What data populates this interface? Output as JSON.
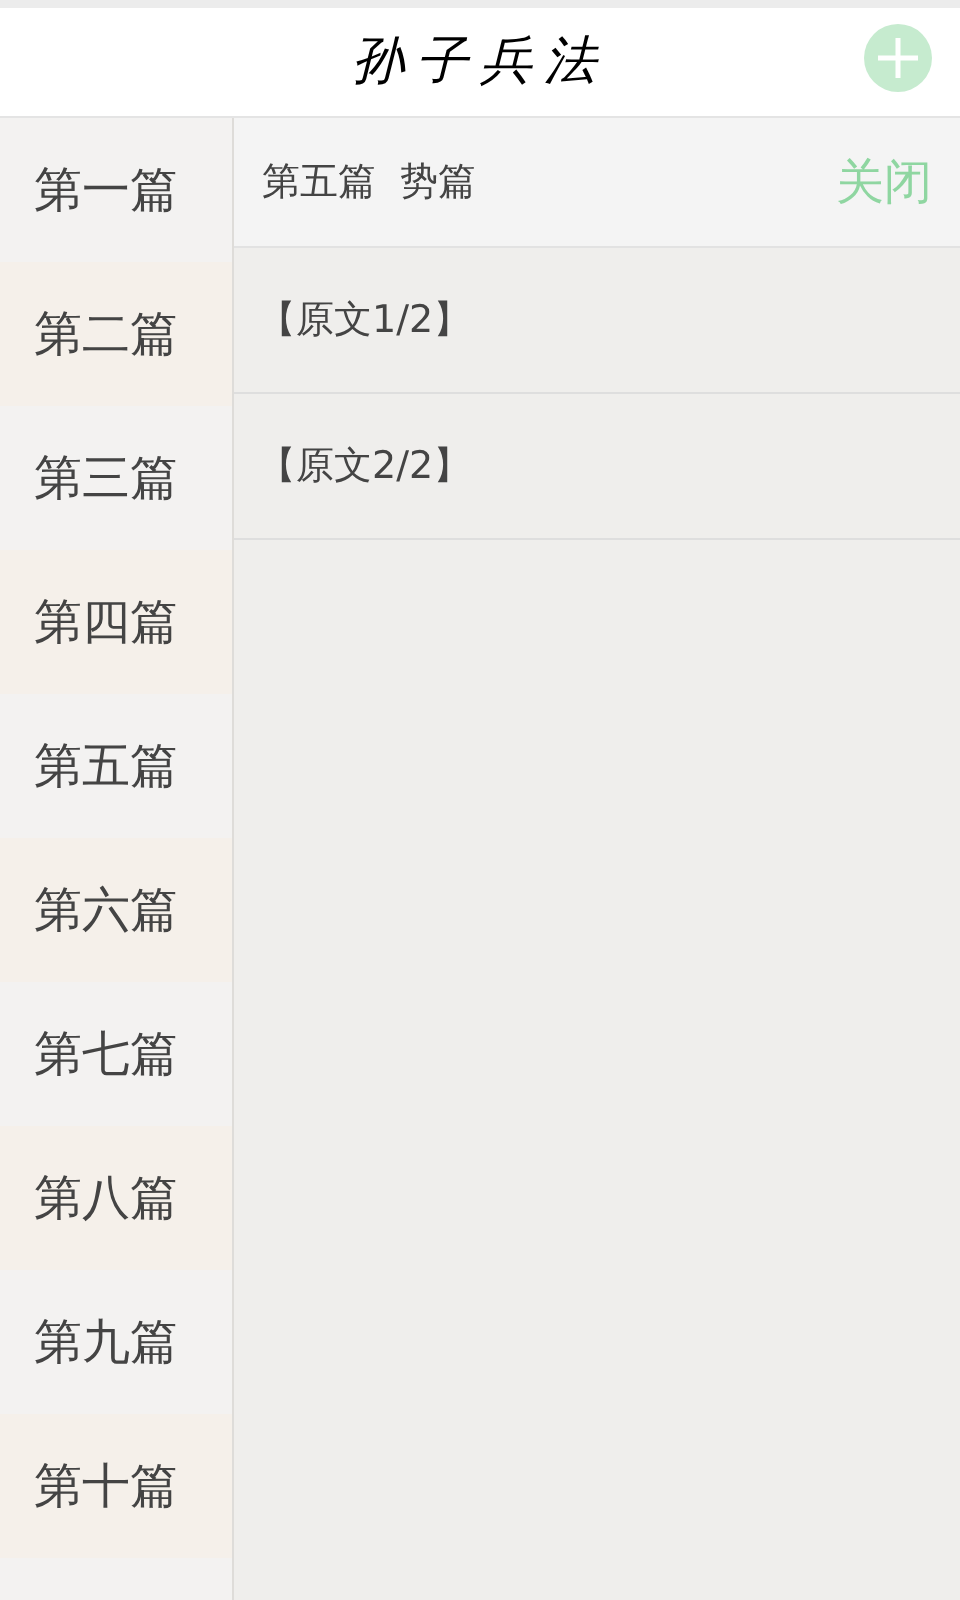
{
  "header": {
    "title": "孙子兵法"
  },
  "sidebar": {
    "items": [
      {
        "label": "第一篇"
      },
      {
        "label": "第二篇"
      },
      {
        "label": "第三篇"
      },
      {
        "label": "第四篇"
      },
      {
        "label": "第五篇"
      },
      {
        "label": "第六篇"
      },
      {
        "label": "第七篇"
      },
      {
        "label": "第八篇"
      },
      {
        "label": "第九篇"
      },
      {
        "label": "第十篇"
      }
    ]
  },
  "panel": {
    "title": "第五篇  势篇",
    "close": "关闭",
    "items": [
      {
        "label": "【原文1/2】"
      },
      {
        "label": "【原文2/2】"
      }
    ]
  }
}
